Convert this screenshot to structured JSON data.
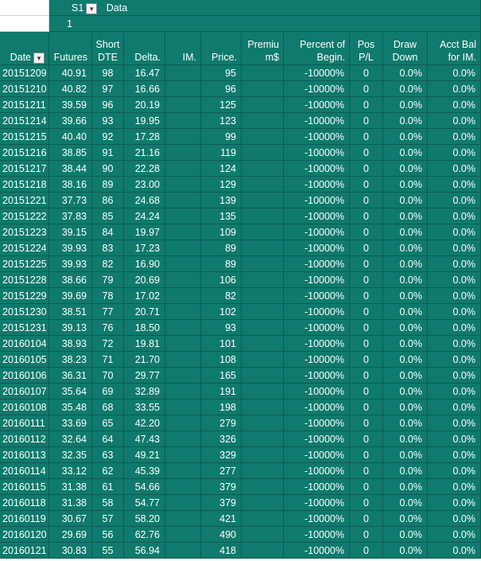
{
  "pivot": {
    "field_s1": "S1",
    "field_data": "Data",
    "s1_value": "1",
    "filter_icon": "filter-dropdown-icon"
  },
  "headers": [
    {
      "line1": "",
      "line2": "Date"
    },
    {
      "line1": "",
      "line2": "Futures"
    },
    {
      "line1": "Short",
      "line2": "DTE"
    },
    {
      "line1": "",
      "line2": "Delta."
    },
    {
      "line1": "",
      "line2": "IM."
    },
    {
      "line1": "",
      "line2": "Price."
    },
    {
      "line1": "Premiu",
      "line2": "m$"
    },
    {
      "line1": "Percent of",
      "line2": "Begin."
    },
    {
      "line1": "Pos",
      "line2": "P/L"
    },
    {
      "line1": "Draw",
      "line2": "Down"
    },
    {
      "line1": "Acct Bal",
      "line2": "for IM."
    }
  ],
  "rows": [
    [
      "20151209",
      "40.91",
      "98",
      "16.47",
      "",
      "95",
      "",
      "-10000%",
      "0",
      "0.0%",
      "0.0%"
    ],
    [
      "20151210",
      "40.82",
      "97",
      "16.66",
      "",
      "96",
      "",
      "-10000%",
      "0",
      "0.0%",
      "0.0%"
    ],
    [
      "20151211",
      "39.59",
      "96",
      "20.19",
      "",
      "125",
      "",
      "-10000%",
      "0",
      "0.0%",
      "0.0%"
    ],
    [
      "20151214",
      "39.66",
      "93",
      "19.95",
      "",
      "123",
      "",
      "-10000%",
      "0",
      "0.0%",
      "0.0%"
    ],
    [
      "20151215",
      "40.40",
      "92",
      "17.28",
      "",
      "99",
      "",
      "-10000%",
      "0",
      "0.0%",
      "0.0%"
    ],
    [
      "20151216",
      "38.85",
      "91",
      "21.16",
      "",
      "119",
      "",
      "-10000%",
      "0",
      "0.0%",
      "0.0%"
    ],
    [
      "20151217",
      "38.44",
      "90",
      "22.28",
      "",
      "124",
      "",
      "-10000%",
      "0",
      "0.0%",
      "0.0%"
    ],
    [
      "20151218",
      "38.16",
      "89",
      "23.00",
      "",
      "129",
      "",
      "-10000%",
      "0",
      "0.0%",
      "0.0%"
    ],
    [
      "20151221",
      "37.73",
      "86",
      "24.68",
      "",
      "139",
      "",
      "-10000%",
      "0",
      "0.0%",
      "0.0%"
    ],
    [
      "20151222",
      "37.83",
      "85",
      "24.24",
      "",
      "135",
      "",
      "-10000%",
      "0",
      "0.0%",
      "0.0%"
    ],
    [
      "20151223",
      "39.15",
      "84",
      "19.97",
      "",
      "109",
      "",
      "-10000%",
      "0",
      "0.0%",
      "0.0%"
    ],
    [
      "20151224",
      "39.93",
      "83",
      "17.23",
      "",
      "89",
      "",
      "-10000%",
      "0",
      "0.0%",
      "0.0%"
    ],
    [
      "20151225",
      "39.93",
      "82",
      "16.90",
      "",
      "89",
      "",
      "-10000%",
      "0",
      "0.0%",
      "0.0%"
    ],
    [
      "20151228",
      "38.66",
      "79",
      "20.69",
      "",
      "106",
      "",
      "-10000%",
      "0",
      "0.0%",
      "0.0%"
    ],
    [
      "20151229",
      "39.69",
      "78",
      "17.02",
      "",
      "82",
      "",
      "-10000%",
      "0",
      "0.0%",
      "0.0%"
    ],
    [
      "20151230",
      "38.51",
      "77",
      "20.71",
      "",
      "102",
      "",
      "-10000%",
      "0",
      "0.0%",
      "0.0%"
    ],
    [
      "20151231",
      "39.13",
      "76",
      "18.50",
      "",
      "93",
      "",
      "-10000%",
      "0",
      "0.0%",
      "0.0%"
    ],
    [
      "20160104",
      "38.93",
      "72",
      "19.81",
      "",
      "101",
      "",
      "-10000%",
      "0",
      "0.0%",
      "0.0%"
    ],
    [
      "20160105",
      "38.23",
      "71",
      "21.70",
      "",
      "108",
      "",
      "-10000%",
      "0",
      "0.0%",
      "0.0%"
    ],
    [
      "20160106",
      "36.31",
      "70",
      "29.77",
      "",
      "165",
      "",
      "-10000%",
      "0",
      "0.0%",
      "0.0%"
    ],
    [
      "20160107",
      "35.64",
      "69",
      "32.89",
      "",
      "191",
      "",
      "-10000%",
      "0",
      "0.0%",
      "0.0%"
    ],
    [
      "20160108",
      "35.48",
      "68",
      "33.55",
      "",
      "198",
      "",
      "-10000%",
      "0",
      "0.0%",
      "0.0%"
    ],
    [
      "20160111",
      "33.69",
      "65",
      "42.20",
      "",
      "279",
      "",
      "-10000%",
      "0",
      "0.0%",
      "0.0%"
    ],
    [
      "20160112",
      "32.64",
      "64",
      "47.43",
      "",
      "326",
      "",
      "-10000%",
      "0",
      "0.0%",
      "0.0%"
    ],
    [
      "20160113",
      "32.35",
      "63",
      "49.21",
      "",
      "329",
      "",
      "-10000%",
      "0",
      "0.0%",
      "0.0%"
    ],
    [
      "20160114",
      "33.12",
      "62",
      "45.39",
      "",
      "277",
      "",
      "-10000%",
      "0",
      "0.0%",
      "0.0%"
    ],
    [
      "20160115",
      "31.38",
      "61",
      "54.66",
      "",
      "379",
      "",
      "-10000%",
      "0",
      "0.0%",
      "0.0%"
    ],
    [
      "20160118",
      "31.38",
      "58",
      "54.77",
      "",
      "379",
      "",
      "-10000%",
      "0",
      "0.0%",
      "0.0%"
    ],
    [
      "20160119",
      "30.67",
      "57",
      "58.20",
      "",
      "421",
      "",
      "-10000%",
      "0",
      "0.0%",
      "0.0%"
    ],
    [
      "20160120",
      "29.69",
      "56",
      "62.76",
      "",
      "490",
      "",
      "-10000%",
      "0",
      "0.0%",
      "0.0%"
    ],
    [
      "20160121",
      "30.83",
      "55",
      "56.94",
      "",
      "418",
      "",
      "-10000%",
      "0",
      "0.0%",
      "0.0%"
    ]
  ],
  "colors": {
    "fill": "#0f7a6d",
    "border": "#0d5c53",
    "text": "#ffffff"
  }
}
